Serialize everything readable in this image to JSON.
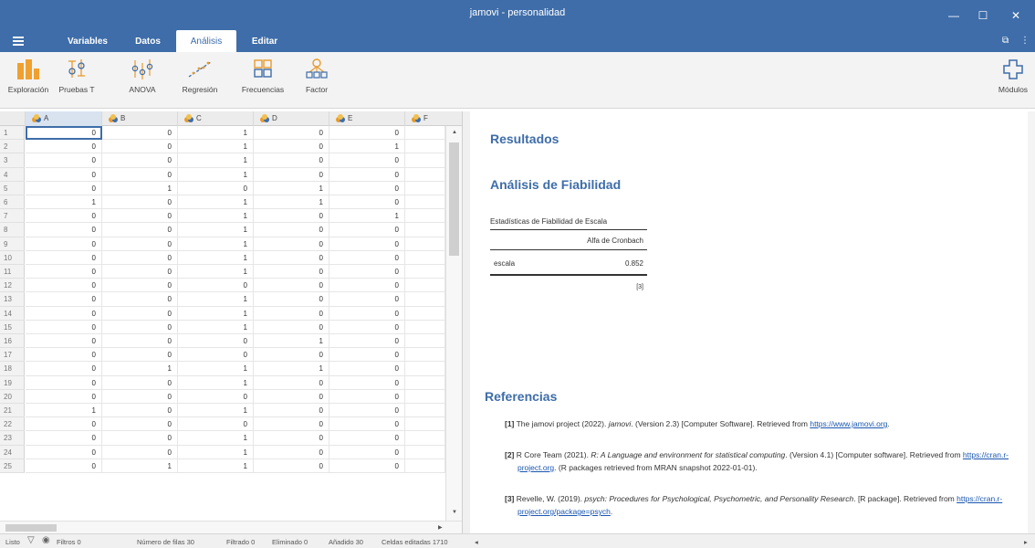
{
  "window": {
    "title": "jamovi - personalidad"
  },
  "menu": {
    "tabs": [
      "Variables",
      "Datos",
      "Análisis",
      "Editar"
    ],
    "active_index": 2
  },
  "ribbon": {
    "buttons": [
      "Exploración",
      "Pruebas T",
      "ANOVA",
      "Regresión",
      "Frecuencias",
      "Factor"
    ],
    "modules_label": "Módulos"
  },
  "colors": {
    "brand": "#3e6da9",
    "link": "#1a57b0",
    "var_icon": "#e89a2c"
  },
  "sheet": {
    "columns": [
      "A",
      "B",
      "C",
      "D",
      "E",
      "F"
    ],
    "rows": [
      {
        "n": "1",
        "v": [
          "0",
          "0",
          "1",
          "0",
          "0"
        ]
      },
      {
        "n": "2",
        "v": [
          "0",
          "0",
          "1",
          "0",
          "1"
        ]
      },
      {
        "n": "3",
        "v": [
          "0",
          "0",
          "1",
          "0",
          "0"
        ]
      },
      {
        "n": "4",
        "v": [
          "0",
          "0",
          "1",
          "0",
          "0"
        ]
      },
      {
        "n": "5",
        "v": [
          "0",
          "1",
          "0",
          "1",
          "0"
        ]
      },
      {
        "n": "6",
        "v": [
          "1",
          "0",
          "1",
          "1",
          "0"
        ]
      },
      {
        "n": "7",
        "v": [
          "0",
          "0",
          "1",
          "0",
          "1"
        ]
      },
      {
        "n": "8",
        "v": [
          "0",
          "0",
          "1",
          "0",
          "0"
        ]
      },
      {
        "n": "9",
        "v": [
          "0",
          "0",
          "1",
          "0",
          "0"
        ]
      },
      {
        "n": "10",
        "v": [
          "0",
          "0",
          "1",
          "0",
          "0"
        ]
      },
      {
        "n": "11",
        "v": [
          "0",
          "0",
          "1",
          "0",
          "0"
        ]
      },
      {
        "n": "12",
        "v": [
          "0",
          "0",
          "0",
          "0",
          "0"
        ]
      },
      {
        "n": "13",
        "v": [
          "0",
          "0",
          "1",
          "0",
          "0"
        ]
      },
      {
        "n": "14",
        "v": [
          "0",
          "0",
          "1",
          "0",
          "0"
        ]
      },
      {
        "n": "15",
        "v": [
          "0",
          "0",
          "1",
          "0",
          "0"
        ]
      },
      {
        "n": "16",
        "v": [
          "0",
          "0",
          "0",
          "1",
          "0"
        ]
      },
      {
        "n": "17",
        "v": [
          "0",
          "0",
          "0",
          "0",
          "0"
        ]
      },
      {
        "n": "18",
        "v": [
          "0",
          "1",
          "1",
          "1",
          "0"
        ]
      },
      {
        "n": "19",
        "v": [
          "0",
          "0",
          "1",
          "0",
          "0"
        ]
      },
      {
        "n": "20",
        "v": [
          "0",
          "0",
          "0",
          "0",
          "0"
        ]
      },
      {
        "n": "21",
        "v": [
          "1",
          "0",
          "1",
          "0",
          "0"
        ]
      },
      {
        "n": "22",
        "v": [
          "0",
          "0",
          "0",
          "0",
          "0"
        ]
      },
      {
        "n": "23",
        "v": [
          "0",
          "0",
          "1",
          "0",
          "0"
        ]
      },
      {
        "n": "24",
        "v": [
          "0",
          "0",
          "1",
          "0",
          "0"
        ]
      },
      {
        "n": "25",
        "v": [
          "0",
          "1",
          "1",
          "0",
          "0"
        ]
      }
    ]
  },
  "results": {
    "heading": "Resultados",
    "analysis_title": "Análisis de Fiabilidad",
    "table": {
      "title": "Estadísticas de Fiabilidad de Escala",
      "header": "Alfa de Cronbach",
      "row_label": "escala",
      "row_value": "0.852",
      "footnote": "[3]"
    },
    "refs_title": "Referencias",
    "refs": [
      {
        "num": "[1]",
        "pre": "The jamovi project (2022). ",
        "italic": "jamovi",
        "post": ". (Version 2.3) [Computer Software]. Retrieved from ",
        "link": "https://www.jamovi.org",
        "tail": "."
      },
      {
        "num": "[2]",
        "pre": "R Core Team (2021). ",
        "italic": "R: A Language and environment for statistical computing",
        "post": ". (Version 4.1) [Computer software]. Retrieved from ",
        "link": "https://cran.r-project.org",
        "tail": ". (R packages retrieved from MRAN snapshot 2022-01-01)."
      },
      {
        "num": "[3]",
        "pre": "Revelle, W. (2019). ",
        "italic": "psych: Procedures for Psychological, Psychometric, and Personality Research",
        "post": ". [R package]. Retrieved from ",
        "link": "https://cran.r-project.org/package=psych",
        "tail": "."
      }
    ]
  },
  "status": {
    "ready": "Listo",
    "filters": "Filtros 0",
    "rows": "Número de filas 30",
    "filtered": "Filtrado 0",
    "deleted": "Eliminado 0",
    "added": "Añadido 30",
    "edited": "Celdas editadas 1710"
  }
}
